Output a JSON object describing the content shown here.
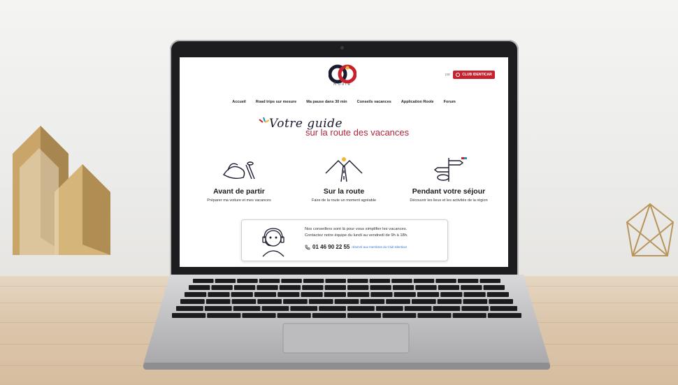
{
  "site": {
    "logo_text": "Roole",
    "by_label": "par",
    "club_label": "CLUB IDENTICAR",
    "nav": [
      "Accueil",
      "Road trips sur mesure",
      "Ma pause dans 30 min",
      "Conseils vacances",
      "Application Roole",
      "Forum"
    ],
    "hero": {
      "line1": "Votre guide",
      "line2": "sur la route des vacances"
    },
    "columns": [
      {
        "icon": "beach-bag-icon",
        "title": "Avant de partir",
        "subtitle": "Préparer ma voiture et mes vacances"
      },
      {
        "icon": "road-mountains-icon",
        "title": "Sur la route",
        "subtitle": "Faire de la route un moment agréable"
      },
      {
        "icon": "signpost-icon",
        "title": "Pendant votre séjour",
        "subtitle": "Découvrir les lieux et les activités de la région"
      }
    ],
    "contact": {
      "line1": "Nos conseillers sont là pour vous simplifier les vacances.",
      "line2": "Contactez notre équipe du lundi au vendredi de 9h à 18h.",
      "phone": "01 46 90 22 55",
      "phone_note": "réservé aux membres du Club Identicar"
    }
  },
  "colors": {
    "brand_red": "#c8212e",
    "hero_red": "#b0263a",
    "navy": "#1a1a2e",
    "link_blue": "#2a6fd6"
  }
}
